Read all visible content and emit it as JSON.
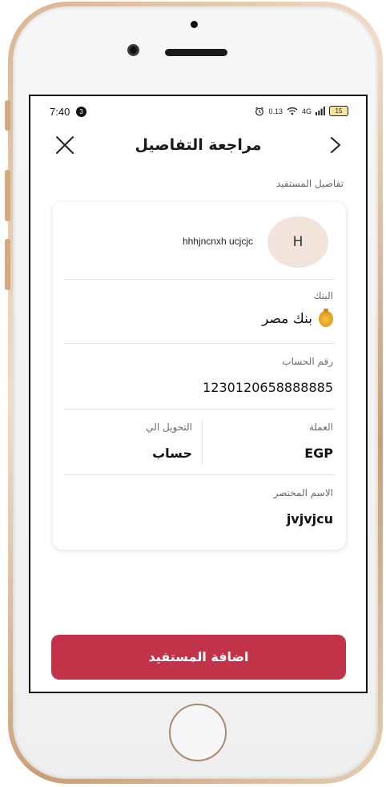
{
  "status_bar": {
    "time": "7:40",
    "notification_count": "3",
    "network_speed": "0.13",
    "signal": "4G",
    "battery": "15"
  },
  "header": {
    "title": "مراجعة التفاصيل"
  },
  "section": {
    "label": "تفاصيل المستفيد"
  },
  "beneficiary": {
    "avatar_initial": "H",
    "name": "hhhjncnxh ucjcjc"
  },
  "fields": {
    "bank_label": "البنك",
    "bank_value": "بنك مصر",
    "account_label": "رقم الحساب",
    "account_value": "1230120658888885",
    "currency_label": "العملة",
    "currency_value": "EGP",
    "transfer_label": "التحويل الي",
    "transfer_value": "حساب",
    "nickname_label": "الاسم المختصر",
    "nickname_value": "jvjvjcu"
  },
  "actions": {
    "add_beneficiary": "اضافة المستفيد"
  },
  "colors": {
    "primary": "#c2334a",
    "avatar_bg": "#f2e4da"
  }
}
